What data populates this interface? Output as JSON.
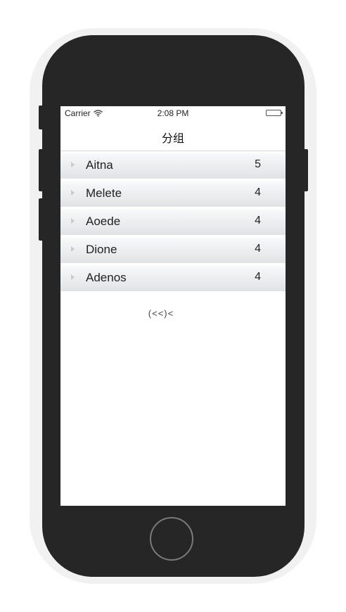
{
  "status_bar": {
    "carrier": "Carrier",
    "time": "2:08 PM"
  },
  "nav": {
    "title": "分组"
  },
  "groups": [
    {
      "name": "Aitna",
      "count": "5"
    },
    {
      "name": "Melete",
      "count": "4"
    },
    {
      "name": "Aoede",
      "count": "4"
    },
    {
      "name": "Dione",
      "count": "4"
    },
    {
      "name": "Adenos",
      "count": "4"
    }
  ],
  "footer": {
    "label": "(<<)<"
  },
  "colors": {
    "phone_body": "#262626",
    "row_gradient_top": "#f5f6f7",
    "row_gradient_bottom": "#dfe1e3"
  },
  "icons": {
    "wifi": "wifi-icon",
    "battery": "battery-icon",
    "disclosure": "disclosure-triangle-icon"
  }
}
